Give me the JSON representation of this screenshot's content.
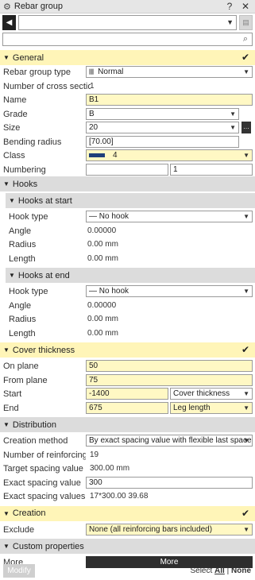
{
  "window": {
    "title": "Rebar group"
  },
  "toolbar": {
    "back_symbol": "◀",
    "combo_value": ""
  },
  "search": {
    "placeholder": ""
  },
  "sections": {
    "general": "General",
    "hooks": "Hooks",
    "hooks_start": "Hooks at start",
    "hooks_end": "Hooks at end",
    "cover": "Cover thickness",
    "distribution": "Distribution",
    "creation": "Creation",
    "custom": "Custom properties"
  },
  "general": {
    "rebar_group_type_label": "Rebar group type",
    "rebar_group_type_value": "Normal",
    "cross_sections_label": "Number of cross sections:",
    "cross_sections_value": "1",
    "name_label": "Name",
    "name_value": "B1",
    "grade_label": "Grade",
    "grade_value": "B",
    "size_label": "Size",
    "size_value": "20",
    "bending_radius_label": "Bending radius",
    "bending_radius_value": "[70.00]",
    "class_label": "Class",
    "class_value": "4",
    "numbering_label": "Numbering",
    "numbering_prefix": "",
    "numbering_value": "1"
  },
  "hooks_start": {
    "hook_type_label": "Hook type",
    "hook_type_value": "— No hook",
    "angle_label": "Angle",
    "angle_value": "0.00000",
    "radius_label": "Radius",
    "radius_value": "0.00 mm",
    "length_label": "Length",
    "length_value": "0.00 mm"
  },
  "hooks_end": {
    "hook_type_label": "Hook type",
    "hook_type_value": "— No hook",
    "angle_label": "Angle",
    "angle_value": "0.00000",
    "radius_label": "Radius",
    "radius_value": "0.00 mm",
    "length_label": "Length",
    "length_value": "0.00 mm"
  },
  "cover": {
    "on_plane_label": "On plane",
    "on_plane_value": "50",
    "from_plane_label": "From plane",
    "from_plane_value": "75",
    "start_label": "Start",
    "start_value": "-1400",
    "start_mode": "Cover thickness",
    "end_label": "End",
    "end_value": "675",
    "end_mode": "Leg length"
  },
  "distribution": {
    "creation_method_label": "Creation method",
    "creation_method_value": "By exact spacing value with flexible last space",
    "num_bars_label": "Number of reinforcing b...",
    "num_bars_value": "19",
    "target_spacing_label": "Target spacing value",
    "target_spacing_value": "300.00 mm",
    "exact_spacing_label": "Exact spacing value",
    "exact_spacing_value": "300",
    "exact_spacing_values_label": "Exact spacing values",
    "exact_spacing_values_value": "17*300.00 39.68"
  },
  "creation": {
    "exclude_label": "Exclude",
    "exclude_value": "None (all reinforcing bars included)"
  },
  "custom": {
    "more_label": "More",
    "more_button": "More"
  },
  "footer": {
    "modify": "Modify",
    "select": "Select",
    "all": "All",
    "separator": "|",
    "none": "None"
  },
  "colors": {
    "section_yellow": "#fff5b8",
    "field_yellow": "#fff8c4",
    "section_gray": "#dcdcdc",
    "class_blue": "#1f3f7a"
  }
}
